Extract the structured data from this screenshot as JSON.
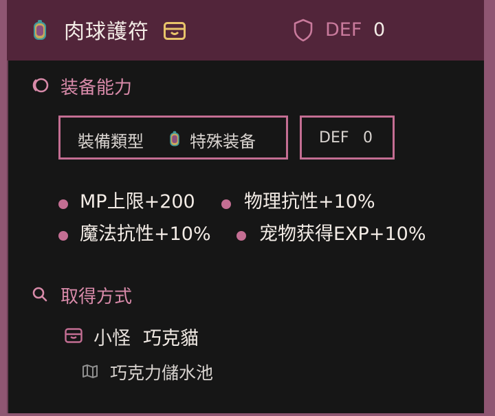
{
  "item": {
    "name": "肉球護符",
    "def_label": "DEF",
    "def_value": "0",
    "icons": {
      "item": "charm-icon",
      "storage": "box-icon",
      "defense": "shield-icon"
    }
  },
  "ability": {
    "title": "装备能力",
    "type_label": "裝備類型",
    "type_value": "特殊装备",
    "def_label": "DEF",
    "def_value": "0",
    "stats": [
      "MP上限+200",
      "物理抗性+10%",
      "魔法抗性+10%",
      "宠物获得EXP+10%"
    ]
  },
  "acquire": {
    "title": "取得方式",
    "source_type": "小怪",
    "source_name": "巧克貓",
    "location": "巧克力儲水池"
  },
  "colors": {
    "header_bg": "#52253a",
    "frame": "#8f5672",
    "accent": "#c46e93",
    "accent_text": "#d88aa9",
    "body_bg": "#161616",
    "gold": "#e8c46a"
  }
}
